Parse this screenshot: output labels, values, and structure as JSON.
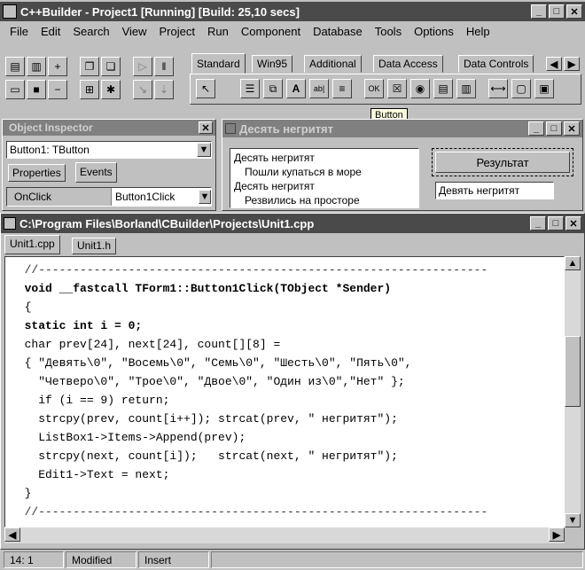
{
  "main_window": {
    "title": "C++Builder - Project1 [Running] [Build: 25,10 secs]"
  },
  "menu": [
    "File",
    "Edit",
    "Search",
    "View",
    "Project",
    "Run",
    "Component",
    "Database",
    "Tools",
    "Options",
    "Help"
  ],
  "palette_tabs": [
    "Standard",
    "Win95",
    "Additional",
    "Data Access",
    "Data Controls"
  ],
  "palette_tooltip": "Button",
  "object_inspector": {
    "title": "Object Inspector",
    "selected": "Button1: TButton",
    "tabs": [
      "Properties",
      "Events"
    ],
    "event": "OnClick",
    "handler": "Button1Click"
  },
  "form": {
    "title": "Десять негритят",
    "listbox": [
      "Десять негритят",
      "Пошли купаться в море",
      "Десять негритят",
      "Резвились на просторе"
    ],
    "button_label": "Результат",
    "edit_value": "Девять негритят"
  },
  "editor": {
    "title": "C:\\Program Files\\Borland\\CBuilder\\Projects\\Unit1.cpp",
    "tabs": [
      "Unit1.cpp",
      "Unit1.h"
    ],
    "lines": [
      "  //-----------------------------------------------------------------",
      "  void __fastcall TForm1::Button1Click(TObject *Sender)",
      "  {",
      "  static int i = 0;",
      "  char prev[24], next[24], count[][8] =",
      "  { \"Девять\\0\", \"Восемь\\0\", \"Семь\\0\", \"Шесть\\0\", \"Пять\\0\",",
      "    \"Четверо\\0\", \"Трое\\0\", \"Двое\\0\", \"Один из\\0\",\"Нет\" };",
      "    if (i == 9) return;",
      "    strcpy(prev, count[i++]); strcat(prev, \" негритят\");",
      "    ListBox1->Items->Append(prev);",
      "    strcpy(next, count[i]);   strcat(next, \" негритят\");",
      "    Edit1->Text = next;",
      "  }",
      "  //-----------------------------------------------------------------"
    ]
  },
  "status": {
    "position": "14: 1",
    "modified": "Modified",
    "mode": "Insert"
  }
}
